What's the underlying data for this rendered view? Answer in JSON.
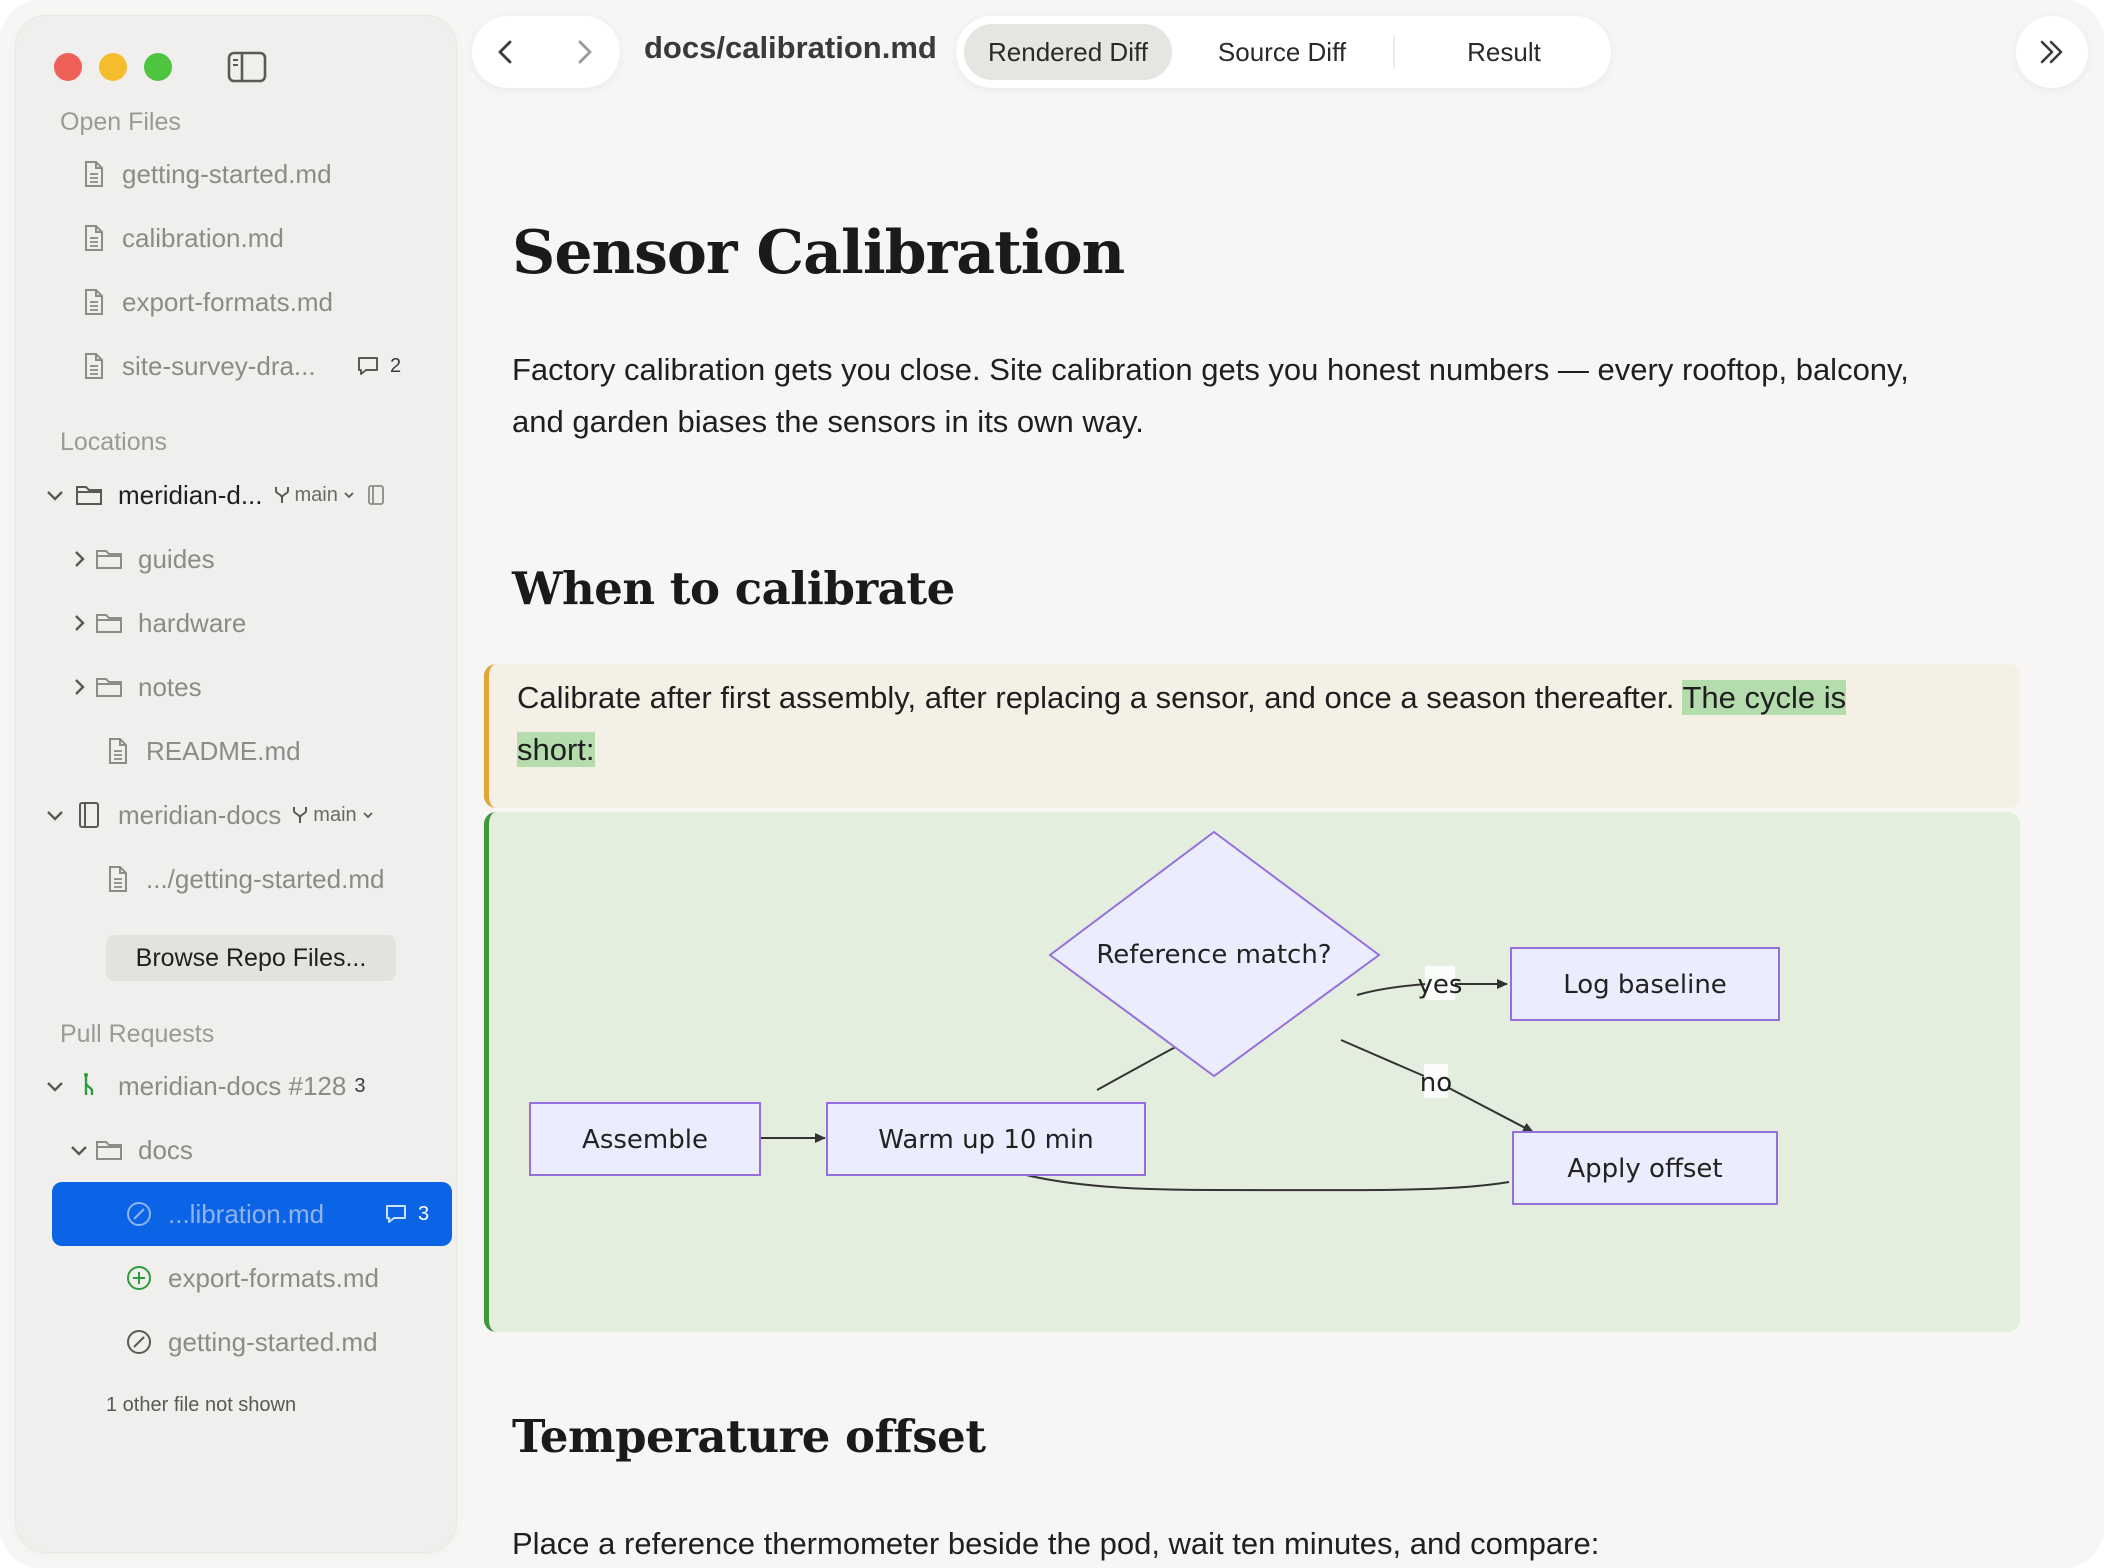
{
  "sidebar": {
    "open_files_heading": "Open Files",
    "open_files": [
      {
        "label": "getting-started.md"
      },
      {
        "label": "calibration.md"
      },
      {
        "label": "export-formats.md"
      },
      {
        "label": "site-survey-dra...",
        "comments": "2"
      }
    ],
    "locations_heading": "Locations",
    "repo1": {
      "label": "meridian-d...",
      "branch": "main"
    },
    "repo1_children": [
      {
        "label": "guides"
      },
      {
        "label": "hardware"
      },
      {
        "label": "notes"
      },
      {
        "label": "README.md"
      }
    ],
    "repo2": {
      "label": "meridian-docs",
      "branch": "main"
    },
    "repo2_children": [
      {
        "label": ".../getting-started.md"
      }
    ],
    "browse_button": "Browse Repo Files...",
    "pull_requests_heading": "Pull Requests",
    "pr": {
      "label": "meridian-docs #128",
      "count": "3"
    },
    "pr_folder": "docs",
    "pr_files": [
      {
        "label": "...libration.md",
        "comments": "3",
        "status": "modified",
        "selected": true
      },
      {
        "label": "export-formats.md",
        "status": "added"
      },
      {
        "label": "getting-started.md",
        "status": "modified"
      }
    ],
    "other_files_note": "1 other file not shown"
  },
  "toolbar": {
    "doc_title": "docs/calibration.md",
    "tabs": [
      {
        "label": "Rendered Diff",
        "active": true
      },
      {
        "label": "Source Diff"
      },
      {
        "label": "Result"
      }
    ]
  },
  "document": {
    "title": "Sensor Calibration",
    "intro_line1": "Factory calibration gets you close. Site calibration gets you honest numbers — every rooftop, balcony,",
    "intro_line2": "and garden biases the sensors in its own way.",
    "section1_heading": "When to calibrate",
    "changed_text": "Calibrate after first assembly, after replacing a sensor, and once a season thereafter.",
    "changed_added_1": "The cycle is",
    "changed_added_2": "short:",
    "flowchart": {
      "nodes": {
        "assemble": "Assemble",
        "warmup": "Warm up 10 min",
        "reference": "Reference match?",
        "log": "Log baseline",
        "apply": "Apply offset"
      },
      "edges": {
        "yes": "yes",
        "no": "no"
      }
    },
    "section2_heading": "Temperature offset",
    "section2_text": "Place a reference thermometer beside the pod, wait ten minutes, and compare:"
  },
  "colors": {
    "accent": "#0b63e5",
    "changed_border": "#e0a437",
    "added_border": "#3c9a3c",
    "highlight": "#b4dcac",
    "node_fill": "#ececff",
    "node_stroke": "#9370db"
  }
}
